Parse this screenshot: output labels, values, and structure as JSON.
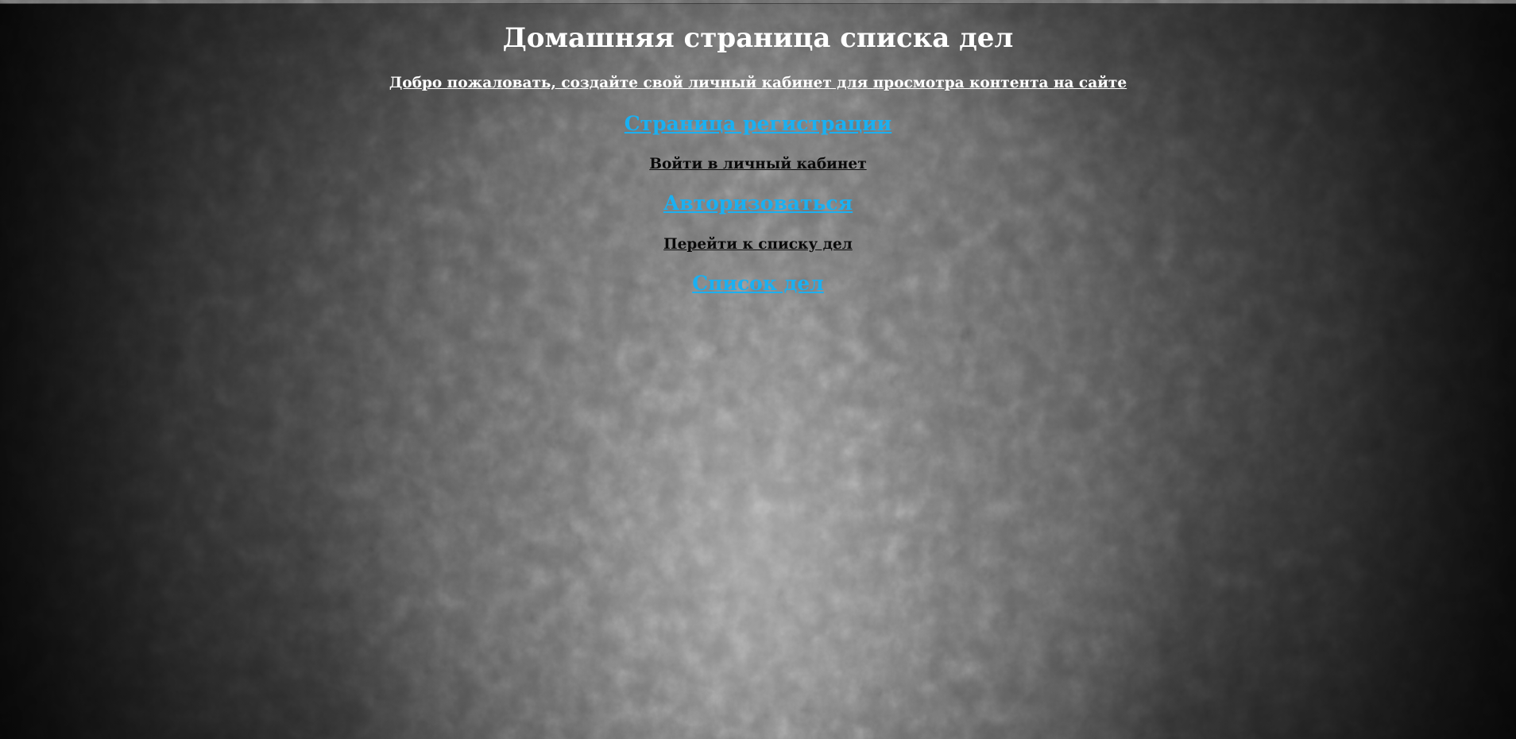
{
  "page": {
    "title": "Домашняя страница списка дел",
    "welcome_text": "Добро пожаловать, создайте свой личный кабинет для просмотра контента на сайте",
    "register_link": "Страница регистрации",
    "login_hint": "Войти в личный кабинет",
    "login_link": "Авторизоваться",
    "todo_hint": "Перейти к списку дел",
    "todo_link": "Список дел"
  },
  "colors": {
    "link": "#1ab0f2",
    "heading": "#ffffff",
    "hint": "#0a0a0a",
    "background": "#5a5a5a"
  }
}
